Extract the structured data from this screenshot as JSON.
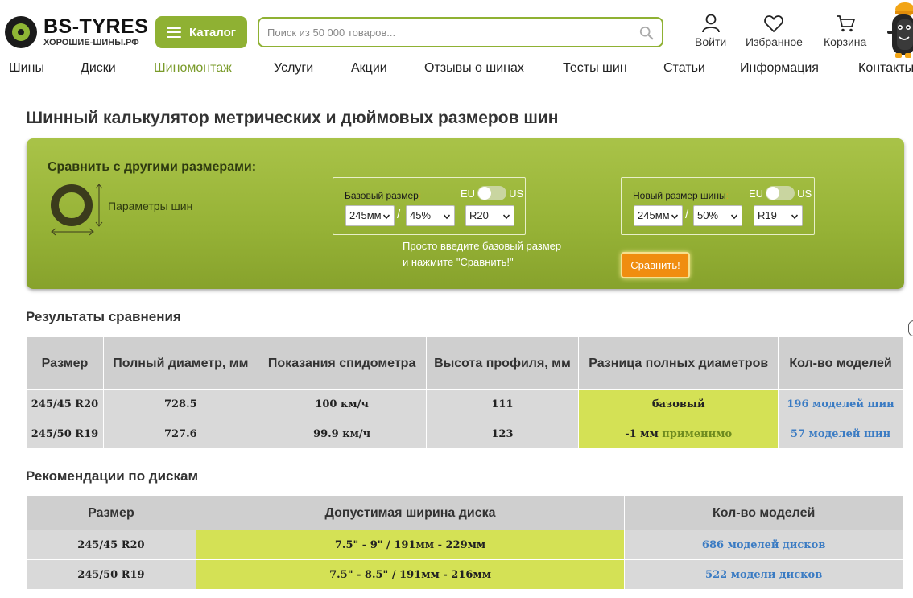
{
  "header": {
    "logo_title": "BS-TYRES",
    "logo_subtitle": "ХОРОШИЕ-ШИНЫ.РФ",
    "catalog_label": "Каталог",
    "search_placeholder": "Поиск из 50 000 товаров...",
    "login_label": "Войти",
    "favorites_label": "Избранное",
    "cart_label": "Корзина"
  },
  "nav": {
    "items": [
      "Шины",
      "Диски",
      "Шиномонтаж",
      "Услуги",
      "Акции",
      "Отзывы о шинах",
      "Тесты шин",
      "Статьи",
      "Информация",
      "Контакты"
    ],
    "active": "Шиномонтаж"
  },
  "page_title": "Шинный калькулятор метрических и дюймовых размеров шин",
  "calculator": {
    "title": "Сравнить с другими размерами:",
    "params_label": "Параметры шин",
    "base": {
      "label": "Базовый размер",
      "toggle_left": "EU",
      "toggle_right": "US",
      "width": "245мм",
      "profile": "45%",
      "rim": "R20"
    },
    "new": {
      "label": "Новый размер шины",
      "toggle_left": "EU",
      "toggle_right": "US",
      "width": "245мм",
      "profile": "50%",
      "rim": "R19"
    },
    "separator": "/",
    "hint_line1": "Просто введите базовый размер",
    "hint_line2": "и нажмите \"Сравнить!\"",
    "compare_label": "Сравнить!"
  },
  "results": {
    "title": "Результаты сравнения",
    "headers": [
      "Размер",
      "Полный диаметр, мм",
      "Показания спидометра",
      "Высота профиля, мм",
      "Разница полных диаметров",
      "Кол-во моделей"
    ],
    "rows": [
      {
        "size": "245/45 R20",
        "diameter": "728.5",
        "speedo": "100 км/ч",
        "profile_height": "111",
        "diff": "базовый",
        "diff_note": "",
        "models": "196 моделей шин"
      },
      {
        "size": "245/50 R19",
        "diameter": "727.6",
        "speedo": "99.9 км/ч",
        "profile_height": "123",
        "diff": "-1 мм",
        "diff_note": "применимо",
        "models": "57 моделей шин"
      }
    ]
  },
  "rims": {
    "title": "Рекомендации по дискам",
    "headers": [
      "Размер",
      "Допустимая ширина диска",
      "Кол-во моделей"
    ],
    "rows": [
      {
        "size": "245/45 R20",
        "width": "7.5\" - 9\" / 191мм - 229мм",
        "models": "686 моделей дисков"
      },
      {
        "size": "245/50 R19",
        "width": "7.5\" - 8.5\" / 191мм - 216мм",
        "models": "522 модели дисков"
      }
    ]
  },
  "colors": {
    "brand_green": "#8fb133",
    "highlight": "#d4e155",
    "link": "#3a7bc3",
    "compare_button": "#f08d10"
  }
}
